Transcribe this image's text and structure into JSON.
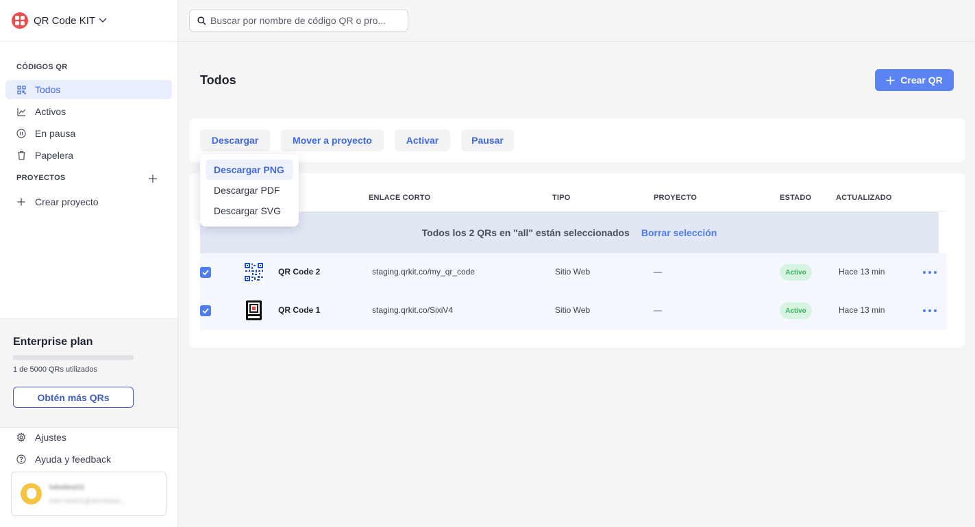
{
  "brand": {
    "name": "QR Code KIT"
  },
  "search": {
    "placeholder": "Buscar por nombre de código QR o pro..."
  },
  "sidebar": {
    "qr_section_title": "CÓDIGOS QR",
    "items": [
      {
        "label": "Todos",
        "icon": "grid-icon"
      },
      {
        "label": "Activos",
        "icon": "chart-icon"
      },
      {
        "label": "En pausa",
        "icon": "pause-icon"
      },
      {
        "label": "Papelera",
        "icon": "trash-icon"
      }
    ],
    "projects_title": "PROYECTOS",
    "create_project_label": "Crear proyecto",
    "settings_label": "Ajustes",
    "help_label": "Ayuda y feedback"
  },
  "plan": {
    "title": "Enterprise plan",
    "usage_text": "1 de 5000 QRs utilizados",
    "usage_fraction": 0.0002,
    "cta_label": "Obtén más QRs"
  },
  "user": {
    "name": "lukeitest11",
    "email": "luke+test11@atomicpix..."
  },
  "main": {
    "title": "Todos",
    "create_label": "Crear QR",
    "actions": [
      "Descargar",
      "Mover a proyecto",
      "Activar",
      "Pausar"
    ],
    "download_menu": [
      "Descargar PNG",
      "Descargar PDF",
      "Descargar SVG"
    ]
  },
  "table": {
    "headers": [
      "ENLACE CORTO",
      "TIPO",
      "PROYECTO",
      "ESTADO",
      "ACTUALIZADO"
    ],
    "selection_text": "Todos los 2 QRs en \"all\" están seleccionados",
    "clear_selection_label": "Borrar selección",
    "rows": [
      {
        "name": "QR Code 2",
        "link": "staging.qrkit.co/my_qr_code",
        "type": "Sitio Web",
        "project": "—",
        "status": "Activo",
        "updated": "Hace 13 min"
      },
      {
        "name": "QR Code 1",
        "link": "staging.qrkit.co/SixiV4",
        "type": "Sitio Web",
        "project": "—",
        "status": "Activo",
        "updated": "Hace 13 min"
      }
    ]
  },
  "colors": {
    "accent": "#4f7cf0",
    "brand": "#ef4d4b",
    "status_active_bg": "#d6f4df",
    "status_active_text": "#3cae64"
  }
}
